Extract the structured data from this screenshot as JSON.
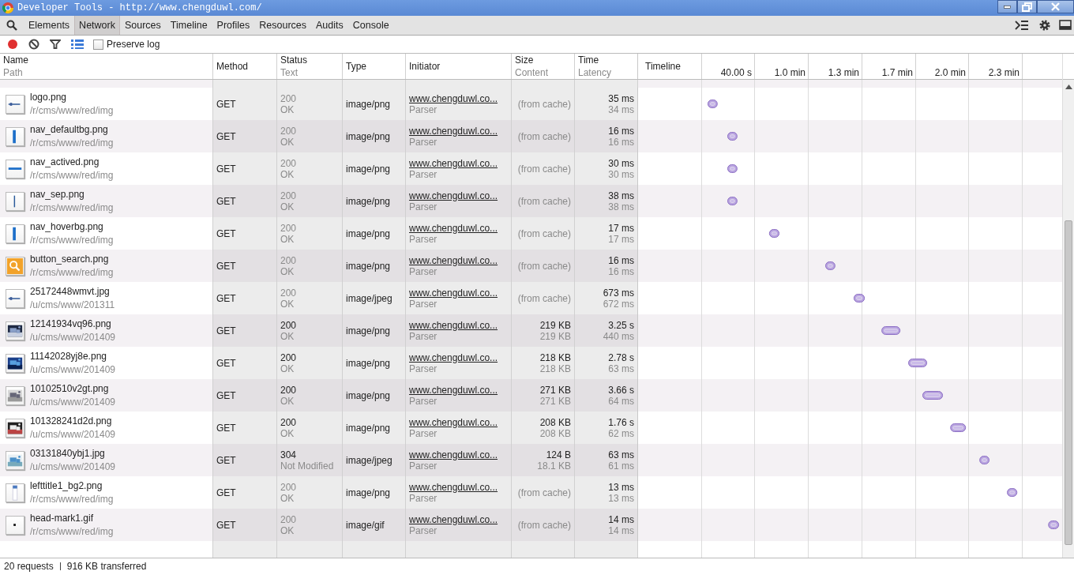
{
  "window": {
    "title": "Developer Tools - http://www.chengduwl.com/"
  },
  "tabs": [
    {
      "label": "Elements",
      "selected": false
    },
    {
      "label": "Network",
      "selected": true
    },
    {
      "label": "Sources",
      "selected": false
    },
    {
      "label": "Timeline",
      "selected": false
    },
    {
      "label": "Profiles",
      "selected": false
    },
    {
      "label": "Resources",
      "selected": false
    },
    {
      "label": "Audits",
      "selected": false
    },
    {
      "label": "Console",
      "selected": false
    }
  ],
  "toolbar": {
    "recording": true,
    "preserve_log": {
      "label": "Preserve log",
      "checked": false
    }
  },
  "columns": [
    {
      "title": "Name",
      "subtitle": "Path"
    },
    {
      "title": "Method"
    },
    {
      "title": "Status",
      "subtitle": "Text"
    },
    {
      "title": "Type"
    },
    {
      "title": "Initiator"
    },
    {
      "title": "Size",
      "subtitle": "Content"
    },
    {
      "title": "Time",
      "subtitle": "Latency"
    }
  ],
  "rows": [
    {
      "kind": "logo",
      "name": "logo.png",
      "path": "/r/cms/www/red/img",
      "method": "GET",
      "status": "200",
      "status_text": "OK",
      "type": "image/png",
      "initiator": "www.chengduwl.co...",
      "initiator_type": "Parser",
      "from_cache": true,
      "size": "(from cache)",
      "time": "35 ms",
      "latency": "34 ms"
    },
    {
      "kind": "vbar",
      "name": "nav_defaultbg.png",
      "path": "/r/cms/www/red/img",
      "method": "GET",
      "status": "200",
      "status_text": "OK",
      "type": "image/png",
      "initiator": "www.chengduwl.co...",
      "initiator_type": "Parser",
      "from_cache": true,
      "size": "(from cache)",
      "time": "16 ms",
      "latency": "16 ms"
    },
    {
      "kind": "hbar",
      "name": "nav_actived.png",
      "path": "/r/cms/www/red/img",
      "method": "GET",
      "status": "200",
      "status_text": "OK",
      "type": "image/png",
      "initiator": "www.chengduwl.co...",
      "initiator_type": "Parser",
      "from_cache": true,
      "size": "(from cache)",
      "time": "30 ms",
      "latency": "30 ms"
    },
    {
      "kind": "vline",
      "name": "nav_sep.png",
      "path": "/r/cms/www/red/img",
      "method": "GET",
      "status": "200",
      "status_text": "OK",
      "type": "image/png",
      "initiator": "www.chengduwl.co...",
      "initiator_type": "Parser",
      "from_cache": true,
      "size": "(from cache)",
      "time": "38 ms",
      "latency": "38 ms"
    },
    {
      "kind": "vbar",
      "name": "nav_hoverbg.png",
      "path": "/r/cms/www/red/img",
      "method": "GET",
      "status": "200",
      "status_text": "OK",
      "type": "image/png",
      "initiator": "www.chengduwl.co...",
      "initiator_type": "Parser",
      "from_cache": true,
      "size": "(from cache)",
      "time": "17 ms",
      "latency": "17 ms"
    },
    {
      "kind": "search",
      "name": "button_search.png",
      "path": "/r/cms/www/red/img",
      "method": "GET",
      "status": "200",
      "status_text": "OK",
      "type": "image/png",
      "initiator": "www.chengduwl.co...",
      "initiator_type": "Parser",
      "from_cache": true,
      "size": "(from cache)",
      "time": "16 ms",
      "latency": "16 ms"
    },
    {
      "kind": "logo",
      "name": "25172448wmvt.jpg",
      "path": "/u/cms/www/201311",
      "method": "GET",
      "status": "200",
      "status_text": "OK",
      "type": "image/jpeg",
      "initiator": "www.chengduwl.co...",
      "initiator_type": "Parser",
      "from_cache": true,
      "size": "(from cache)",
      "time": "673 ms",
      "latency": "672 ms"
    },
    {
      "name": "12141934vq96.png",
      "path": "/u/cms/www/201409",
      "method": "GET",
      "status": "200",
      "status_text": "OK",
      "type": "image/png",
      "initiator": "www.chengduwl.co...",
      "initiator_type": "Parser",
      "from_cache": false,
      "size": "219 KB",
      "content": "219 KB",
      "time": "3.25 s",
      "latency": "440 ms"
    },
    {
      "name": "11142028yj8e.png",
      "path": "/u/cms/www/201409",
      "method": "GET",
      "status": "200",
      "status_text": "OK",
      "type": "image/png",
      "initiator": "www.chengduwl.co...",
      "initiator_type": "Parser",
      "from_cache": false,
      "size": "218 KB",
      "content": "218 KB",
      "time": "2.78 s",
      "latency": "63 ms"
    },
    {
      "name": "10102510v2gt.png",
      "path": "/u/cms/www/201409",
      "method": "GET",
      "status": "200",
      "status_text": "OK",
      "type": "image/png",
      "initiator": "www.chengduwl.co...",
      "initiator_type": "Parser",
      "from_cache": false,
      "size": "271 KB",
      "content": "271 KB",
      "time": "3.66 s",
      "latency": "64 ms"
    },
    {
      "name": "101328241d2d.png",
      "path": "/u/cms/www/201409",
      "method": "GET",
      "status": "200",
      "status_text": "OK",
      "type": "image/png",
      "initiator": "www.chengduwl.co...",
      "initiator_type": "Parser",
      "from_cache": false,
      "size": "208 KB",
      "content": "208 KB",
      "time": "1.76 s",
      "latency": "62 ms"
    },
    {
      "name": "03131840ybj1.jpg",
      "path": "/u/cms/www/201409",
      "method": "GET",
      "status": "304",
      "status_text": "Not Modified",
      "type": "image/jpeg",
      "initiator": "www.chengduwl.co...",
      "initiator_type": "Parser",
      "from_cache": false,
      "size": "124 B",
      "content": "18.1 KB",
      "time": "63 ms",
      "latency": "61 ms"
    },
    {
      "kind": "panel",
      "name": "lefttitle1_bg2.png",
      "path": "/r/cms/www/red/img",
      "method": "GET",
      "status": "200",
      "status_text": "OK",
      "type": "image/png",
      "initiator": "www.chengduwl.co...",
      "initiator_type": "Parser",
      "from_cache": true,
      "size": "(from cache)",
      "time": "13 ms",
      "latency": "13 ms"
    },
    {
      "kind": "dot",
      "name": "head-mark1.gif",
      "path": "/r/cms/www/red/img",
      "method": "GET",
      "status": "200",
      "status_text": "OK",
      "type": "image/gif",
      "initiator": "www.chengduwl.co...",
      "initiator_type": "Parser",
      "from_cache": true,
      "size": "(from cache)",
      "time": "14 ms",
      "latency": "14 ms"
    }
  ],
  "timeline": {
    "title": "Timeline",
    "ticks": [
      "40.00 s",
      "1.0 min",
      "1.3 min",
      "1.7 min",
      "2.0 min",
      "2.3 min"
    ]
  },
  "status_bar": {
    "requests": "20 requests",
    "transferred": "916 KB transferred"
  }
}
